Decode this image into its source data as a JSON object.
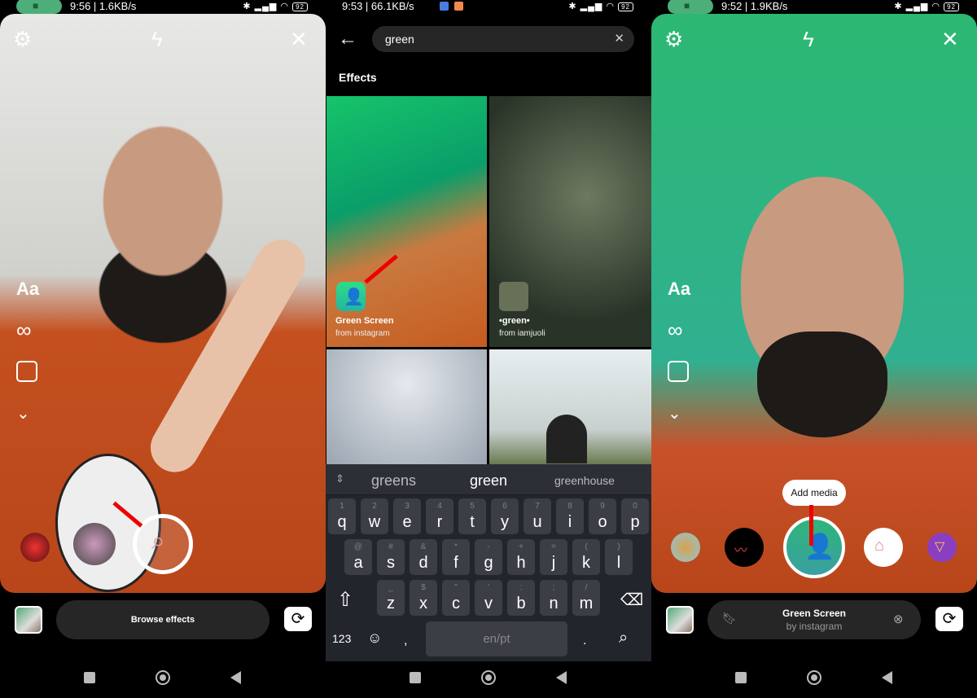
{
  "panels": [
    {
      "status": {
        "time": "9:56 | 1.6KB/s",
        "battery": "92"
      },
      "side_tools": {
        "text": "Aa",
        "boomerang_icon": "infinity-icon",
        "layout_icon": "layout-icon",
        "more_icon": "chevron-down-icon"
      },
      "top_icons": [
        "settings-icon",
        "flash-off-icon",
        "close-icon"
      ],
      "bottom": {
        "browse_label": "Browse effects"
      }
    },
    {
      "status": {
        "time": "9:53 | 66.1KB/s",
        "battery": "92"
      },
      "search": {
        "value": "green"
      },
      "section_title": "Effects",
      "effects": [
        {
          "name": "Green Screen",
          "author": "from instagram"
        },
        {
          "name": "•green•",
          "author": "from iamjuoli"
        },
        {
          "name": "",
          "author": ""
        },
        {
          "name": "",
          "author": ""
        }
      ],
      "keyboard": {
        "suggestions": [
          "greens",
          "green",
          "greenhouse"
        ],
        "row1": [
          [
            "1",
            "q"
          ],
          [
            "2",
            "w"
          ],
          [
            "3",
            "e"
          ],
          [
            "4",
            "r"
          ],
          [
            "5",
            "t"
          ],
          [
            "6",
            "y"
          ],
          [
            "7",
            "u"
          ],
          [
            "8",
            "i"
          ],
          [
            "9",
            "o"
          ],
          [
            "0",
            "p"
          ]
        ],
        "row2": [
          [
            "@",
            "a"
          ],
          [
            "#",
            "s"
          ],
          [
            "&",
            "d"
          ],
          [
            "*",
            "f"
          ],
          [
            "-",
            "g"
          ],
          [
            "+",
            "h"
          ],
          [
            "=",
            "j"
          ],
          [
            "(",
            "k"
          ],
          [
            ")",
            "l"
          ]
        ],
        "row3": [
          [
            "_",
            "z"
          ],
          [
            "$",
            "x"
          ],
          [
            "\"",
            "c"
          ],
          [
            "'",
            "v"
          ],
          [
            ":",
            "b"
          ],
          [
            ";",
            "n"
          ],
          [
            "/",
            "m"
          ]
        ],
        "numbers_label": "123",
        "space_label": "en/pt",
        "comma": ",",
        "period": "."
      }
    },
    {
      "status": {
        "time": "9:52 | 1.9KB/s",
        "battery": "92"
      },
      "tooltip": "Add media",
      "effect": {
        "name": "Green Screen",
        "author": "by instagram"
      }
    }
  ],
  "colors": {
    "accent_red": "#e00000",
    "green_screen": "#2fb57a",
    "shirt": "#c8512a"
  }
}
